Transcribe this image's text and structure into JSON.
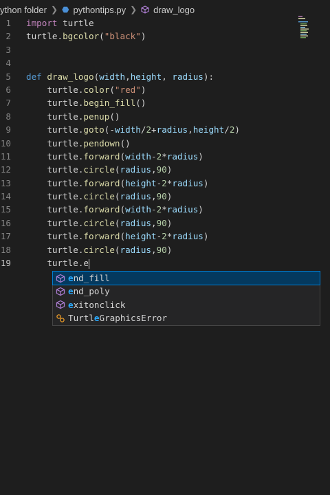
{
  "breadcrumb": {
    "folder": "ython folder",
    "file": "pythontips.py",
    "symbol": "draw_logo"
  },
  "code_lines": [
    {
      "n": "1",
      "parts": [
        [
          "kw",
          "import"
        ],
        [
          "plain",
          " turtle"
        ]
      ]
    },
    {
      "n": "2",
      "parts": [
        [
          "plain",
          "turtle."
        ],
        [
          "fn",
          "bgcolor"
        ],
        [
          "plain",
          "("
        ],
        [
          "str",
          "\"black\""
        ],
        [
          "plain",
          ")"
        ]
      ]
    },
    {
      "n": "3",
      "parts": []
    },
    {
      "n": "4",
      "parts": []
    },
    {
      "n": "5",
      "parts": [
        [
          "def",
          "def"
        ],
        [
          "plain",
          " "
        ],
        [
          "fn",
          "draw_logo"
        ],
        [
          "plain",
          "("
        ],
        [
          "var",
          "width"
        ],
        [
          "plain",
          ","
        ],
        [
          "var",
          "height"
        ],
        [
          "plain",
          ", "
        ],
        [
          "var",
          "radius"
        ],
        [
          "plain",
          "):"
        ]
      ]
    },
    {
      "n": "6",
      "parts": [
        [
          "plain",
          "    turtle."
        ],
        [
          "fn",
          "color"
        ],
        [
          "plain",
          "("
        ],
        [
          "str",
          "\"red\""
        ],
        [
          "plain",
          ")"
        ]
      ]
    },
    {
      "n": "7",
      "parts": [
        [
          "plain",
          "    turtle."
        ],
        [
          "fn",
          "begin_fill"
        ],
        [
          "plain",
          "()"
        ]
      ]
    },
    {
      "n": "8",
      "parts": [
        [
          "plain",
          "    turtle."
        ],
        [
          "fn",
          "penup"
        ],
        [
          "plain",
          "()"
        ]
      ]
    },
    {
      "n": "9",
      "parts": [
        [
          "plain",
          "    turtle."
        ],
        [
          "fn",
          "goto"
        ],
        [
          "plain",
          "(-"
        ],
        [
          "var",
          "width"
        ],
        [
          "plain",
          "/"
        ],
        [
          "num",
          "2"
        ],
        [
          "plain",
          "+"
        ],
        [
          "var",
          "radius"
        ],
        [
          "plain",
          ","
        ],
        [
          "var",
          "height"
        ],
        [
          "plain",
          "/"
        ],
        [
          "num",
          "2"
        ],
        [
          "plain",
          ")"
        ]
      ]
    },
    {
      "n": "10",
      "parts": [
        [
          "plain",
          "    turtle."
        ],
        [
          "fn",
          "pendown"
        ],
        [
          "plain",
          "()"
        ]
      ]
    },
    {
      "n": "11",
      "parts": [
        [
          "plain",
          "    turtle."
        ],
        [
          "fn",
          "forward"
        ],
        [
          "plain",
          "("
        ],
        [
          "var",
          "width"
        ],
        [
          "plain",
          "-"
        ],
        [
          "num",
          "2"
        ],
        [
          "plain",
          "*"
        ],
        [
          "var",
          "radius"
        ],
        [
          "plain",
          ")"
        ]
      ]
    },
    {
      "n": "12",
      "parts": [
        [
          "plain",
          "    turtle."
        ],
        [
          "fn",
          "circle"
        ],
        [
          "plain",
          "("
        ],
        [
          "var",
          "radius"
        ],
        [
          "plain",
          ","
        ],
        [
          "num",
          "90"
        ],
        [
          "plain",
          ")"
        ]
      ]
    },
    {
      "n": "13",
      "parts": [
        [
          "plain",
          "    turtle."
        ],
        [
          "fn",
          "forward"
        ],
        [
          "plain",
          "("
        ],
        [
          "var",
          "height"
        ],
        [
          "plain",
          "-"
        ],
        [
          "num",
          "2"
        ],
        [
          "plain",
          "*"
        ],
        [
          "var",
          "radius"
        ],
        [
          "plain",
          ")"
        ]
      ]
    },
    {
      "n": "14",
      "parts": [
        [
          "plain",
          "    turtle."
        ],
        [
          "fn",
          "circle"
        ],
        [
          "plain",
          "("
        ],
        [
          "var",
          "radius"
        ],
        [
          "plain",
          ","
        ],
        [
          "num",
          "90"
        ],
        [
          "plain",
          ")"
        ]
      ]
    },
    {
      "n": "15",
      "parts": [
        [
          "plain",
          "    turtle."
        ],
        [
          "fn",
          "forward"
        ],
        [
          "plain",
          "("
        ],
        [
          "var",
          "width"
        ],
        [
          "plain",
          "-"
        ],
        [
          "num",
          "2"
        ],
        [
          "plain",
          "*"
        ],
        [
          "var",
          "radius"
        ],
        [
          "plain",
          ")"
        ]
      ]
    },
    {
      "n": "16",
      "parts": [
        [
          "plain",
          "    turtle."
        ],
        [
          "fn",
          "circle"
        ],
        [
          "plain",
          "("
        ],
        [
          "var",
          "radius"
        ],
        [
          "plain",
          ","
        ],
        [
          "num",
          "90"
        ],
        [
          "plain",
          ")"
        ]
      ]
    },
    {
      "n": "17",
      "parts": [
        [
          "plain",
          "    turtle."
        ],
        [
          "fn",
          "forward"
        ],
        [
          "plain",
          "("
        ],
        [
          "var",
          "height"
        ],
        [
          "plain",
          "-"
        ],
        [
          "num",
          "2"
        ],
        [
          "plain",
          "*"
        ],
        [
          "var",
          "radius"
        ],
        [
          "plain",
          ")"
        ]
      ]
    },
    {
      "n": "18",
      "parts": [
        [
          "plain",
          "    turtle."
        ],
        [
          "fn",
          "circle"
        ],
        [
          "plain",
          "("
        ],
        [
          "var",
          "radius"
        ],
        [
          "plain",
          ","
        ],
        [
          "num",
          "90"
        ],
        [
          "plain",
          ")"
        ]
      ]
    },
    {
      "n": "19",
      "parts": [
        [
          "plain",
          "    turtle.e"
        ]
      ],
      "current": true
    }
  ],
  "suggestions": {
    "typed": "e",
    "items": [
      {
        "label": "end_fill",
        "icon": "method-icon",
        "selected": true
      },
      {
        "label": "end_poly",
        "icon": "method-icon",
        "selected": false
      },
      {
        "label": "exitonclick",
        "icon": "method-icon",
        "selected": false
      },
      {
        "label": "TurtleGraphicsError",
        "icon": "class-icon",
        "selected": false
      }
    ]
  },
  "colors": {
    "background": "#1e1e1e",
    "keyword": "#c586c0",
    "def_keyword": "#569cd6",
    "function": "#dcdcaa",
    "string": "#ce9178",
    "number": "#b5cea8",
    "variable": "#9cdcfe",
    "match_highlight": "#2aaaff",
    "selection": "#04395e"
  }
}
